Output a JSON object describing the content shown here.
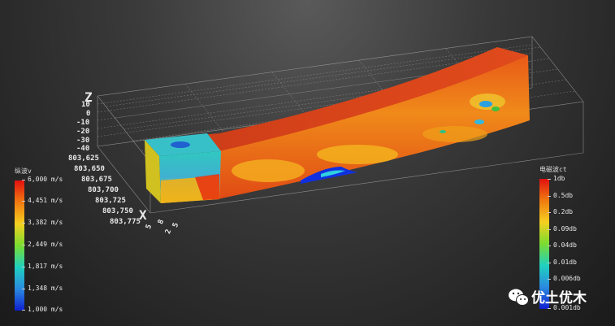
{
  "left_legend": {
    "title": "纵波v",
    "ticks": [
      "6,000 m/s",
      "4,451 m/s",
      "3,382 m/s",
      "2,449 m/s",
      "1,817 m/s",
      "1,348 m/s",
      "1,000 m/s"
    ],
    "colors": [
      "#e01010",
      "#f07a10",
      "#f5d020",
      "#7adc30",
      "#20d0c0",
      "#2a8ae0",
      "#1020d0"
    ]
  },
  "right_legend": {
    "title": "电磁波ct",
    "ticks": [
      "1db",
      "0.5db",
      "0.2db",
      "0.09db",
      "0.04db",
      "0.01db",
      "0.006db",
      "0.001db"
    ],
    "colors": [
      "#e01010",
      "#f07a10",
      "#f5d020",
      "#7adc30",
      "#20d0c0",
      "#2a8ae0",
      "#1020d0"
    ]
  },
  "axes": {
    "z_title": "Z",
    "z_ticks": [
      "10",
      "0",
      "-10",
      "-20",
      "-30",
      "-40"
    ],
    "x_title": "X",
    "x_ticks": [
      "803,625",
      "803,650",
      "803,675",
      "803,700",
      "803,725",
      "803,750",
      "803,775"
    ],
    "y_ticks": [
      "5",
      "8",
      "2",
      "5"
    ]
  },
  "watermark": {
    "text": "优土优木",
    "icon": "wechat-icon"
  }
}
